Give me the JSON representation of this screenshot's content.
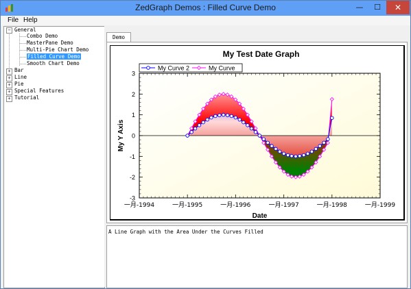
{
  "window": {
    "title": "ZedGraph Demos : Filled Curve Demo",
    "min_glyph": "—",
    "max_glyph": "☐",
    "close_glyph": "✕"
  },
  "menu": [
    "File",
    "Help"
  ],
  "tree": {
    "groups": [
      {
        "label": "General",
        "expanded": true,
        "children": [
          {
            "label": "Combo Demo"
          },
          {
            "label": "MasterPane Demo"
          },
          {
            "label": "Multi-Pie Chart Demo"
          },
          {
            "label": "Filled Curve Demo",
            "selected": true
          },
          {
            "label": "Smooth Chart Demo"
          }
        ]
      },
      {
        "label": "Bar",
        "expanded": false
      },
      {
        "label": "Line",
        "expanded": false
      },
      {
        "label": "Pie",
        "expanded": false
      },
      {
        "label": "Special Features",
        "expanded": false
      },
      {
        "label": "Tutorial",
        "expanded": false
      }
    ]
  },
  "tabs": [
    "Demo"
  ],
  "description": "A Line Graph with the Area Under the Curves Filled",
  "chart_data": {
    "type": "line",
    "title": "My Test Date Graph",
    "xlabel": "Date",
    "ylabel": "My Y Axis",
    "x_tick_labels": [
      "一月-1994",
      "一月-1995",
      "一月-1996",
      "一月-1997",
      "一月-1998",
      "一月-1999"
    ],
    "x_ticks": [
      "1994-01-01",
      "1995-01-01",
      "1996-01-01",
      "1997-01-01",
      "1998-01-01",
      "1999-01-01"
    ],
    "xlim": [
      "1994-01-01",
      "1999-01-01"
    ],
    "ylim": [
      -3,
      3
    ],
    "y_ticks": [
      -3,
      -2,
      -1,
      0,
      1,
      2,
      3
    ],
    "x": [
      "1995-01-01",
      "1995-02-01",
      "1995-03-01",
      "1995-04-01",
      "1995-05-01",
      "1995-06-01",
      "1995-07-01",
      "1995-08-01",
      "1995-09-01",
      "1995-10-01",
      "1995-11-01",
      "1995-12-01",
      "1996-01-01",
      "1996-02-01",
      "1996-03-01",
      "1996-04-01",
      "1996-05-01",
      "1996-06-01",
      "1996-07-01",
      "1996-08-01",
      "1996-09-01",
      "1996-10-01",
      "1996-11-01",
      "1996-12-01",
      "1997-01-01",
      "1997-02-01",
      "1997-03-01",
      "1997-04-01",
      "1997-05-01",
      "1997-06-01",
      "1997-07-01",
      "1997-08-01",
      "1997-09-01",
      "1997-10-01",
      "1997-11-01",
      "1997-12-01"
    ],
    "series": [
      {
        "name": "My Curve 2",
        "color": "#0000ff",
        "marker": "circle",
        "fill": "blue-white-red",
        "values": [
          0.0,
          0.17,
          0.34,
          0.5,
          0.64,
          0.77,
          0.87,
          0.94,
          0.98,
          1.0,
          0.98,
          0.94,
          0.87,
          0.77,
          0.64,
          0.5,
          0.34,
          0.17,
          0.0,
          -0.17,
          -0.34,
          -0.5,
          -0.64,
          -0.77,
          -0.87,
          -0.94,
          -0.98,
          -1.0,
          -0.98,
          -0.94,
          -0.87,
          -0.77,
          -0.64,
          -0.5,
          -0.34,
          -0.17
        ]
      },
      {
        "name": "My Curve",
        "color": "#ff00ff",
        "marker": "diamond",
        "fill": "white-red-green",
        "values": [
          0.0,
          0.35,
          0.68,
          1.0,
          1.29,
          1.53,
          1.73,
          1.88,
          1.97,
          2.0,
          1.97,
          1.88,
          1.73,
          1.53,
          1.29,
          1.0,
          0.68,
          0.35,
          0.0,
          -0.35,
          -0.68,
          -1.0,
          -1.29,
          -1.53,
          -1.73,
          -1.88,
          -1.97,
          -2.0,
          -1.97,
          -1.88,
          -1.73,
          -1.53,
          -1.29,
          -1.0,
          -0.68,
          -0.35
        ]
      }
    ],
    "extra_points": {
      "x": [
        "1998-01-01"
      ],
      "My Curve 2": [
        0.85
      ],
      "My Curve": [
        1.75
      ]
    },
    "legend_position": "top-left",
    "grid": false,
    "background": "#fffde8"
  }
}
